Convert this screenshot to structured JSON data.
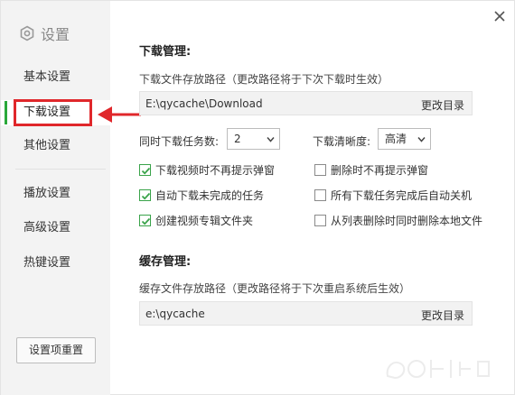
{
  "sidebar": {
    "title": "设置",
    "items": [
      {
        "label": "基本设置",
        "active": false
      },
      {
        "label": "下载设置",
        "active": true
      },
      {
        "label": "其他设置",
        "active": false
      },
      {
        "label": "播放设置",
        "active": false
      },
      {
        "label": "高级设置",
        "active": false
      },
      {
        "label": "热键设置",
        "active": false
      }
    ],
    "reset_label": "设置项重置"
  },
  "download": {
    "section_title": "下载管理:",
    "path_label": "下载文件存放路径（更改路径将于下次下载时生效）",
    "path_value": "E:\\qycache\\Download",
    "change_label": "更改目录",
    "tasks_label": "同时下载任务数:",
    "tasks_value": "2",
    "clarity_label": "下载清晰度:",
    "clarity_value": "高清",
    "options": [
      {
        "label": "下载视频时不再提示弹窗",
        "checked": true
      },
      {
        "label": "删除时不再提示弹窗",
        "checked": false
      },
      {
        "label": "自动下载未完成的任务",
        "checked": true
      },
      {
        "label": "所有下载任务完成后自动关机",
        "checked": false
      },
      {
        "label": "创建视频专辑文件夹",
        "checked": true
      },
      {
        "label": "从列表删除时同时删除本地文件",
        "checked": false
      }
    ]
  },
  "cache": {
    "section_title": "缓存管理:",
    "path_label": "缓存文件存放路径（更改路径将于下次重启系统后生效）",
    "path_value": "e:\\qycache",
    "change_label": "更改目录"
  },
  "colors": {
    "accent": "#2aa83a",
    "annotation": "#e0272b",
    "sidebar_bg": "#f3f3f3"
  }
}
